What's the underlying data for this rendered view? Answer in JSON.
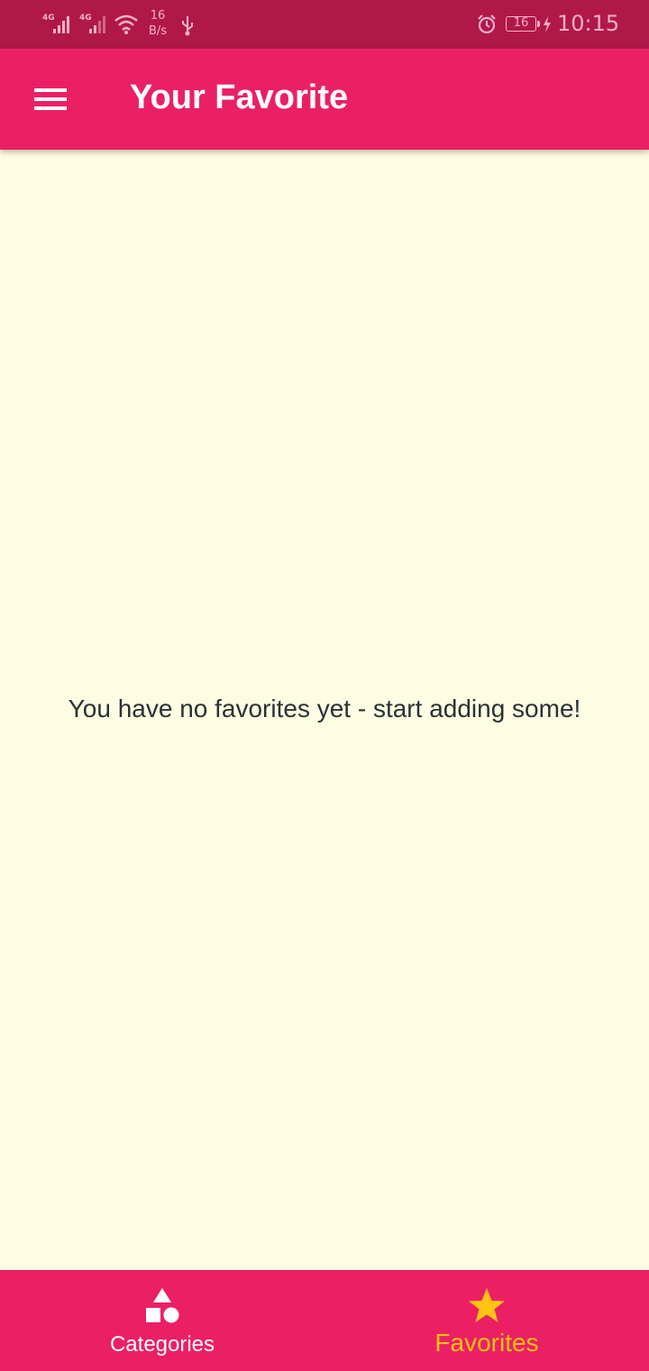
{
  "status_bar": {
    "net1": "4G",
    "net2": "4G",
    "speed_value": "16",
    "speed_unit": "B/s",
    "battery": "16",
    "time": "10:15",
    "icons": [
      "signal-icon",
      "signal-icon",
      "wifi-icon",
      "usb-icon",
      "alarm-icon",
      "battery-icon",
      "charging-icon"
    ]
  },
  "app_bar": {
    "title": "Your Favorite",
    "menu_icon": "hamburger-menu-icon"
  },
  "main": {
    "empty_message": "You have no favorites yet - start adding some!"
  },
  "bottom_nav": {
    "items": [
      {
        "label": "Categories",
        "icon": "shapes-icon",
        "selected": false
      },
      {
        "label": "Favorites",
        "icon": "star-icon",
        "selected": true
      }
    ]
  },
  "colors": {
    "primary": "#EB2064",
    "status_bar": "#B1184A",
    "background": "#FEFCE3",
    "accent": "#FFC312",
    "text": "#2A3235"
  }
}
